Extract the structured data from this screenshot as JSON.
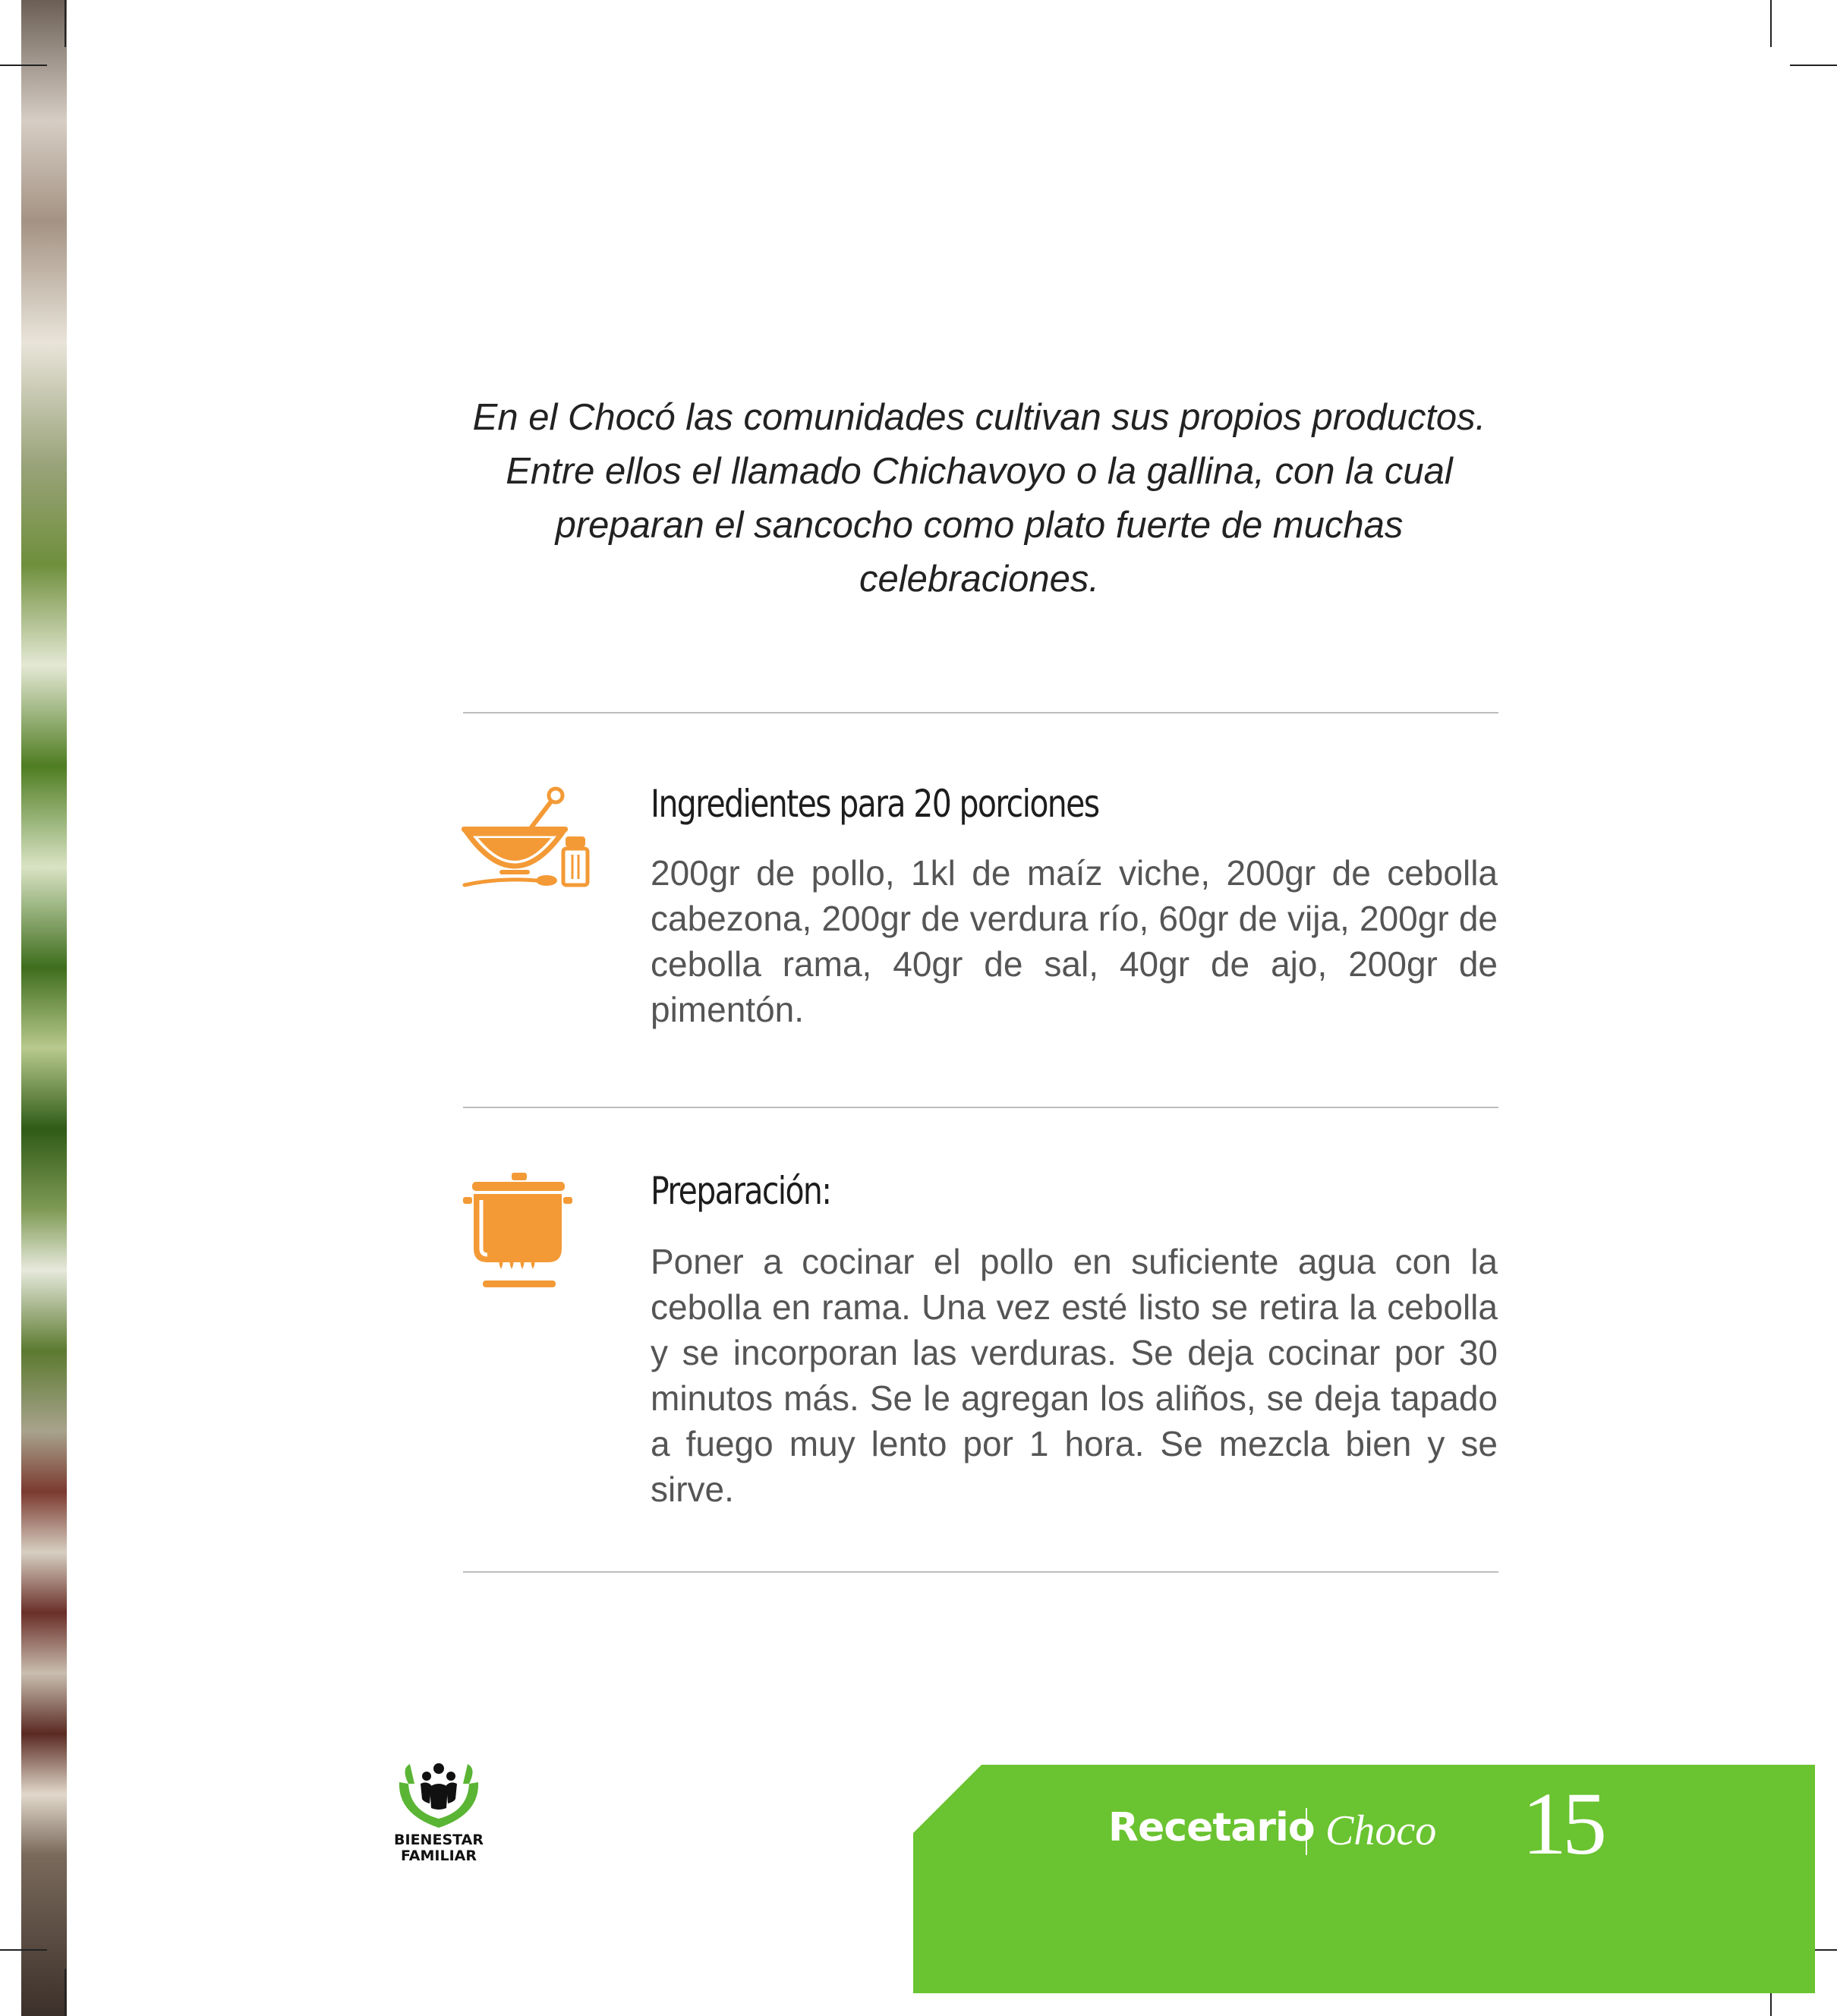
{
  "intro": "En el Chocó las comunidades cultivan sus propios productos. Entre ellos el llamado Chichavoyo o la gallina, con la cual preparan el sancocho como plato fuerte de muchas celebraciones.",
  "ingredients": {
    "icon": "mortar-bowl-salt-icon",
    "title": "Ingredientes para 20 porciones",
    "body": "200gr de pollo, 1kl de maíz viche, 200gr de cebolla cabezona, 200gr de verdura río, 60gr de vija, 200gr de cebolla rama, 40gr de sal, 40gr de ajo, 200gr de pimentón."
  },
  "preparation": {
    "icon": "cooking-pot-icon",
    "title": "Preparación:",
    "body": "Poner a cocinar el pollo en suficiente agua con la cebolla en rama. Una vez esté listo se retira la cebolla y se incorporan las verduras. Se deja cocinar por 30 minutos más. Se le agregan los aliños, se deja tapado a fuego muy lento por 1 hora. Se mezcla bien y se sirve."
  },
  "logo": {
    "line1": "BIENESTAR",
    "line2": "FAMILIAR"
  },
  "footer": {
    "title": "Recetario",
    "place": "Choco",
    "page_number": "15"
  },
  "colors": {
    "accent_orange": "#f39a36",
    "footer_green": "#6ac330"
  }
}
